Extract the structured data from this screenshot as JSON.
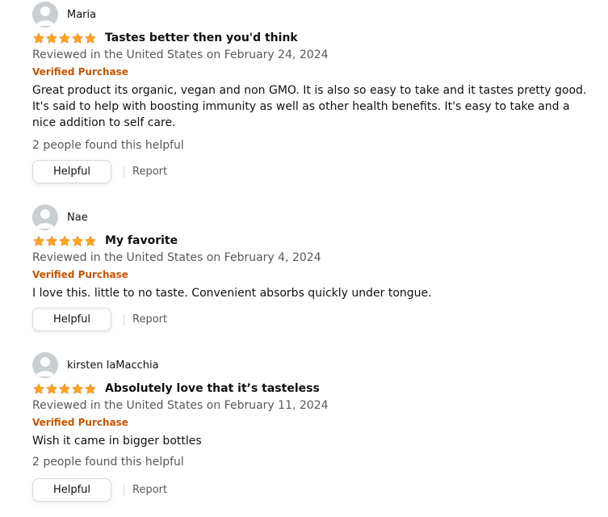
{
  "reviews": [
    {
      "author": "Maria",
      "rating": 5,
      "title": "Tastes better then you'd think",
      "date_line": "Reviewed in the United States on February 24, 2024",
      "verified": "Verified Purchase",
      "body": "Great product its organic, vegan and non GMO. It is also so easy to take and it tastes pretty good. It's said to help with boosting immunity as well as other health benefits. It's easy to take and a nice addition to self care.",
      "helpful_count": "2 people found this helpful",
      "helpful_label": "Helpful",
      "report_label": "Report"
    },
    {
      "author": "Nae",
      "rating": 5,
      "title": "My favorite",
      "date_line": "Reviewed in the United States on February 4, 2024",
      "verified": "Verified Purchase",
      "body": "I love this. little to no taste. Convenient absorbs quickly under tongue.",
      "helpful_label": "Helpful",
      "report_label": "Report"
    },
    {
      "author": "kirsten laMacchia",
      "rating": 5,
      "title": "Absolutely love that it’s tasteless",
      "date_line": "Reviewed in the United States on February 11, 2024",
      "verified": "Verified Purchase",
      "body": "Wish it came in bigger bottles",
      "helpful_count": "2 people found this helpful",
      "helpful_label": "Helpful",
      "report_label": "Report"
    }
  ],
  "icons": {
    "avatar": "user-silhouette-icon",
    "star": "star-filled-icon"
  },
  "colors": {
    "star": "#ffa41c",
    "verified": "#c45500",
    "meta": "#565959"
  }
}
